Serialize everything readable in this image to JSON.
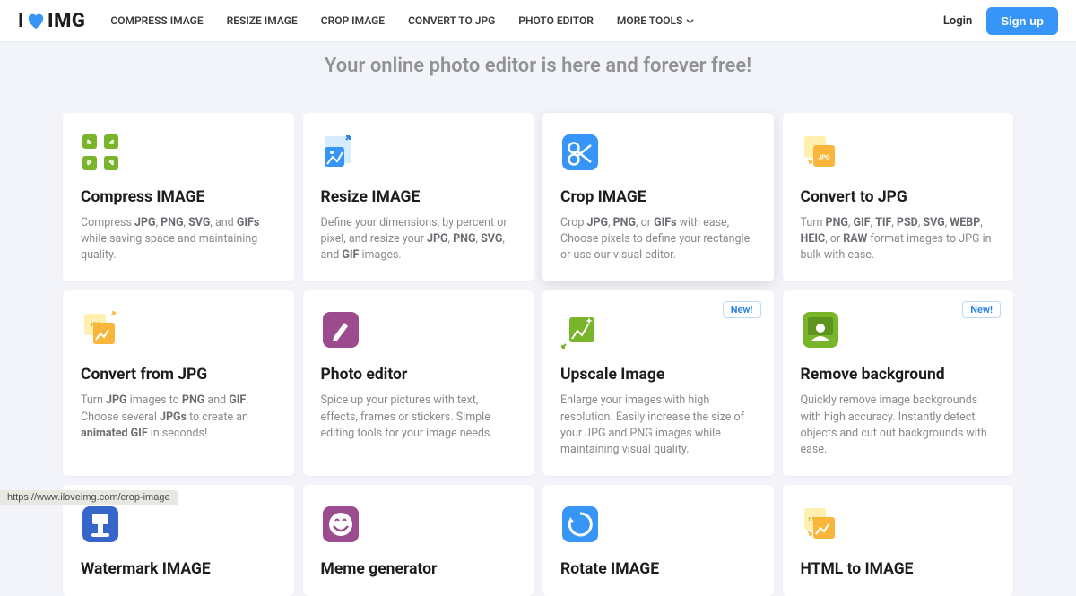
{
  "header": {
    "logo_left": "I",
    "logo_right": "IMG",
    "nav": {
      "compress": "COMPRESS IMAGE",
      "resize": "RESIZE IMAGE",
      "crop": "CROP IMAGE",
      "convert": "CONVERT TO JPG",
      "editor": "PHOTO EDITOR",
      "more": "MORE TOOLS"
    },
    "login": "Login",
    "signup": "Sign up"
  },
  "hero": {
    "headline": "Your online photo editor is here and forever free!"
  },
  "badges": {
    "new": "New!"
  },
  "cards": {
    "compress": {
      "title": "Compress IMAGE",
      "desc_pre": "Compress ",
      "desc_b1": "JPG",
      "desc_sep1": ", ",
      "desc_b2": "PNG",
      "desc_sep2": ", ",
      "desc_b3": "SVG",
      "desc_sep3": ", and ",
      "desc_b4": "GIFs",
      "desc_post": " while saving space and maintaining quality."
    },
    "resize": {
      "title": "Resize IMAGE",
      "desc_pre": "Define your dimensions, by percent or pixel, and resize your ",
      "desc_b1": "JPG",
      "desc_sep1": ", ",
      "desc_b2": "PNG",
      "desc_sep2": ", ",
      "desc_b3": "SVG",
      "desc_sep3": ", and ",
      "desc_b4": "GIF",
      "desc_post": " images."
    },
    "crop": {
      "title": "Crop IMAGE",
      "desc_pre": "Crop ",
      "desc_b1": "JPG",
      "desc_sep1": ", ",
      "desc_b2": "PNG",
      "desc_sep2": ", or ",
      "desc_b3": "GIFs",
      "desc_post": " with ease; Choose pixels to define your rectangle or use our visual editor."
    },
    "tojpg": {
      "title": "Convert to JPG",
      "desc_pre": "Turn ",
      "desc_b1": "PNG",
      "desc_sep1": ", ",
      "desc_b2": "GIF",
      "desc_sep2": ", ",
      "desc_b3": "TIF",
      "desc_sep3": ", ",
      "desc_b4": "PSD",
      "desc_sep4": ", ",
      "desc_b5": "SVG",
      "desc_sep5": ", ",
      "desc_b6": "WEBP",
      "desc_sep6": ", ",
      "desc_b7": "HEIC",
      "desc_sep7": ", or ",
      "desc_b8": "RAW",
      "desc_post": " format images to JPG in bulk with ease."
    },
    "fromjpg": {
      "title": "Convert from JPG",
      "d1": "Turn ",
      "b1": "JPG",
      "d2": " images to ",
      "b2": "PNG",
      "d3": " and ",
      "b3": "GIF",
      "d4": ". Choose several ",
      "b4": "JPGs",
      "d5": " to create an ",
      "b5": "animated GIF",
      "d6": " in seconds!"
    },
    "editor": {
      "title": "Photo editor",
      "desc": "Spice up your pictures with text, effects, frames or stickers. Simple editing tools for your image needs."
    },
    "upscale": {
      "title": "Upscale Image",
      "desc": "Enlarge your images with high resolution. Easily increase the size of your JPG and PNG images while maintaining visual quality."
    },
    "removebg": {
      "title": "Remove background",
      "desc": "Quickly remove image backgrounds with high accuracy. Instantly detect objects and cut out backgrounds with ease."
    },
    "watermark": {
      "title": "Watermark IMAGE"
    },
    "meme": {
      "title": "Meme generator"
    },
    "rotate": {
      "title": "Rotate IMAGE"
    },
    "html": {
      "title": "HTML to IMAGE"
    }
  },
  "status_url": "https://www.iloveimg.com/crop-image",
  "colors": {
    "blue": "#3695f6",
    "green": "#79b52b",
    "purple": "#9c4b8e",
    "yellow": "#f9d24a",
    "darkblue": "#3666c9"
  }
}
